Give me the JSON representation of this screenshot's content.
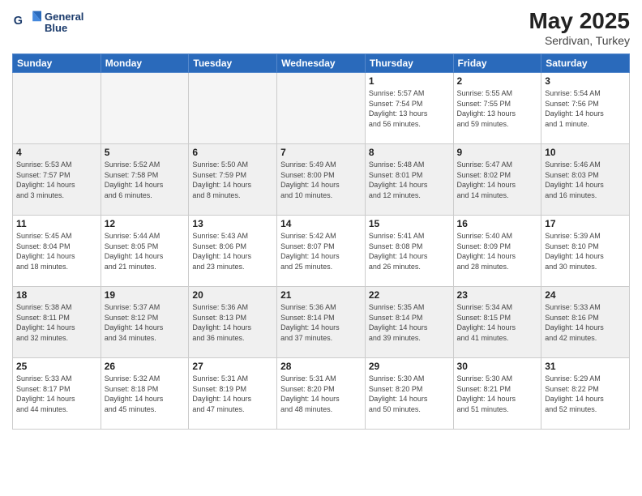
{
  "header": {
    "logo_line1": "General",
    "logo_line2": "Blue",
    "month_year": "May 2025",
    "location": "Serdivan, Turkey"
  },
  "days_of_week": [
    "Sunday",
    "Monday",
    "Tuesday",
    "Wednesday",
    "Thursday",
    "Friday",
    "Saturday"
  ],
  "weeks": [
    [
      {
        "day": "",
        "info": "",
        "empty": true
      },
      {
        "day": "",
        "info": "",
        "empty": true
      },
      {
        "day": "",
        "info": "",
        "empty": true
      },
      {
        "day": "",
        "info": "",
        "empty": true
      },
      {
        "day": "1",
        "info": "Sunrise: 5:57 AM\nSunset: 7:54 PM\nDaylight: 13 hours\nand 56 minutes."
      },
      {
        "day": "2",
        "info": "Sunrise: 5:55 AM\nSunset: 7:55 PM\nDaylight: 13 hours\nand 59 minutes."
      },
      {
        "day": "3",
        "info": "Sunrise: 5:54 AM\nSunset: 7:56 PM\nDaylight: 14 hours\nand 1 minute."
      }
    ],
    [
      {
        "day": "4",
        "info": "Sunrise: 5:53 AM\nSunset: 7:57 PM\nDaylight: 14 hours\nand 3 minutes."
      },
      {
        "day": "5",
        "info": "Sunrise: 5:52 AM\nSunset: 7:58 PM\nDaylight: 14 hours\nand 6 minutes."
      },
      {
        "day": "6",
        "info": "Sunrise: 5:50 AM\nSunset: 7:59 PM\nDaylight: 14 hours\nand 8 minutes."
      },
      {
        "day": "7",
        "info": "Sunrise: 5:49 AM\nSunset: 8:00 PM\nDaylight: 14 hours\nand 10 minutes."
      },
      {
        "day": "8",
        "info": "Sunrise: 5:48 AM\nSunset: 8:01 PM\nDaylight: 14 hours\nand 12 minutes."
      },
      {
        "day": "9",
        "info": "Sunrise: 5:47 AM\nSunset: 8:02 PM\nDaylight: 14 hours\nand 14 minutes."
      },
      {
        "day": "10",
        "info": "Sunrise: 5:46 AM\nSunset: 8:03 PM\nDaylight: 14 hours\nand 16 minutes."
      }
    ],
    [
      {
        "day": "11",
        "info": "Sunrise: 5:45 AM\nSunset: 8:04 PM\nDaylight: 14 hours\nand 18 minutes."
      },
      {
        "day": "12",
        "info": "Sunrise: 5:44 AM\nSunset: 8:05 PM\nDaylight: 14 hours\nand 21 minutes."
      },
      {
        "day": "13",
        "info": "Sunrise: 5:43 AM\nSunset: 8:06 PM\nDaylight: 14 hours\nand 23 minutes."
      },
      {
        "day": "14",
        "info": "Sunrise: 5:42 AM\nSunset: 8:07 PM\nDaylight: 14 hours\nand 25 minutes."
      },
      {
        "day": "15",
        "info": "Sunrise: 5:41 AM\nSunset: 8:08 PM\nDaylight: 14 hours\nand 26 minutes."
      },
      {
        "day": "16",
        "info": "Sunrise: 5:40 AM\nSunset: 8:09 PM\nDaylight: 14 hours\nand 28 minutes."
      },
      {
        "day": "17",
        "info": "Sunrise: 5:39 AM\nSunset: 8:10 PM\nDaylight: 14 hours\nand 30 minutes."
      }
    ],
    [
      {
        "day": "18",
        "info": "Sunrise: 5:38 AM\nSunset: 8:11 PM\nDaylight: 14 hours\nand 32 minutes."
      },
      {
        "day": "19",
        "info": "Sunrise: 5:37 AM\nSunset: 8:12 PM\nDaylight: 14 hours\nand 34 minutes."
      },
      {
        "day": "20",
        "info": "Sunrise: 5:36 AM\nSunset: 8:13 PM\nDaylight: 14 hours\nand 36 minutes."
      },
      {
        "day": "21",
        "info": "Sunrise: 5:36 AM\nSunset: 8:14 PM\nDaylight: 14 hours\nand 37 minutes."
      },
      {
        "day": "22",
        "info": "Sunrise: 5:35 AM\nSunset: 8:14 PM\nDaylight: 14 hours\nand 39 minutes."
      },
      {
        "day": "23",
        "info": "Sunrise: 5:34 AM\nSunset: 8:15 PM\nDaylight: 14 hours\nand 41 minutes."
      },
      {
        "day": "24",
        "info": "Sunrise: 5:33 AM\nSunset: 8:16 PM\nDaylight: 14 hours\nand 42 minutes."
      }
    ],
    [
      {
        "day": "25",
        "info": "Sunrise: 5:33 AM\nSunset: 8:17 PM\nDaylight: 14 hours\nand 44 minutes."
      },
      {
        "day": "26",
        "info": "Sunrise: 5:32 AM\nSunset: 8:18 PM\nDaylight: 14 hours\nand 45 minutes."
      },
      {
        "day": "27",
        "info": "Sunrise: 5:31 AM\nSunset: 8:19 PM\nDaylight: 14 hours\nand 47 minutes."
      },
      {
        "day": "28",
        "info": "Sunrise: 5:31 AM\nSunset: 8:20 PM\nDaylight: 14 hours\nand 48 minutes."
      },
      {
        "day": "29",
        "info": "Sunrise: 5:30 AM\nSunset: 8:20 PM\nDaylight: 14 hours\nand 50 minutes."
      },
      {
        "day": "30",
        "info": "Sunrise: 5:30 AM\nSunset: 8:21 PM\nDaylight: 14 hours\nand 51 minutes."
      },
      {
        "day": "31",
        "info": "Sunrise: 5:29 AM\nSunset: 8:22 PM\nDaylight: 14 hours\nand 52 minutes."
      }
    ]
  ]
}
